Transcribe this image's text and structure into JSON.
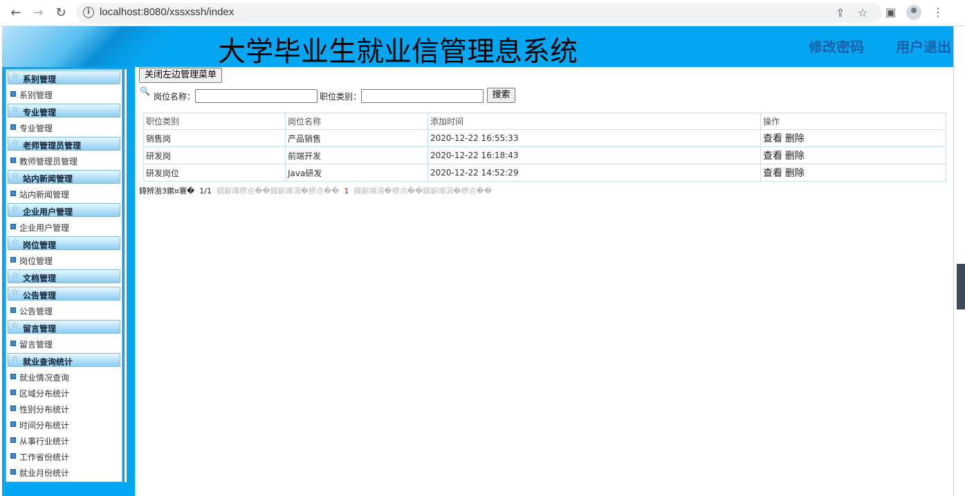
{
  "browser": {
    "url": "localhost:8080/xssxssh/index"
  },
  "header": {
    "title": "大学毕业生就业信管理息系统",
    "change_password": "修改密码",
    "logout": "用户退出"
  },
  "sidebar": {
    "groups": [
      {
        "title": "系别管理",
        "items": [
          "系别管理"
        ]
      },
      {
        "title": "专业管理",
        "items": [
          "专业管理"
        ]
      },
      {
        "title": "老师管理员管理",
        "items": [
          "教师管理员管理"
        ]
      },
      {
        "title": "站内新闻管理",
        "items": [
          "站内新闻管理"
        ]
      },
      {
        "title": "企业用户管理",
        "items": [
          "企业用户管理"
        ]
      },
      {
        "title": "岗位管理",
        "items": [
          "岗位管理"
        ]
      },
      {
        "title": "文档管理",
        "items": []
      },
      {
        "title": "公告管理",
        "items": [
          "公告管理"
        ]
      },
      {
        "title": "留言管理",
        "items": [
          "留言管理"
        ]
      },
      {
        "title": "就业查询统计",
        "items": [
          "就业情况查询",
          "区域分布统计",
          "性别分布统计",
          "时间分布统计",
          "从事行业统计",
          "工作省份统计",
          "就业月份统计"
        ]
      }
    ]
  },
  "main": {
    "close_menu_button": "关闭左边管理菜单",
    "search": {
      "job_name_label": "岗位名称：",
      "job_category_label": "职位类别：",
      "job_name_value": "",
      "job_category_value": "",
      "search_button": "搜索"
    },
    "table": {
      "headers": [
        "职位类别",
        "岗位名称",
        "添加时间",
        "操作"
      ],
      "rows": [
        {
          "category": "销售岗",
          "name": "产品销售",
          "time": "2020-12-22 16:55:33",
          "view": "查看",
          "delete": "删除"
        },
        {
          "category": "研发岗",
          "name": "前端开发",
          "time": "2020-12-22 16:18:43",
          "view": "查看",
          "delete": "删除"
        },
        {
          "category": "研发岗位",
          "name": "Java研发",
          "time": "2020-12-22 14:52:29",
          "view": "查看",
          "delete": "删除"
        }
      ]
    },
    "pager": {
      "prefix": "鍏辨湁3鏉¤褰�",
      "page_info": "1/1",
      "first_prev": "鍓嶄竴椤点��鍓嶄竴涓�椤点��",
      "current": "1",
      "next_last": "鍓嶄竴涓�椤点��鍓嶄竴涓�椤点��"
    }
  }
}
